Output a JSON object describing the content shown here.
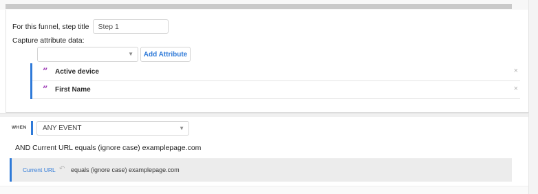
{
  "step": {
    "label": "For this funnel, step title",
    "title_value": "Step 1"
  },
  "capture": {
    "label": "Capture attribute data:",
    "select_value": "",
    "add_button": "Add Attribute",
    "attributes": [
      {
        "name": "Active device",
        "icon": "quote-icon",
        "remove": "×"
      },
      {
        "name": "First Name",
        "icon": "quote-icon",
        "remove": "×"
      }
    ]
  },
  "trigger": {
    "when_label": "WHEN",
    "event_value": "ANY EVENT",
    "and_text": "AND Current URL equals (ignore case) examplepage.com",
    "filter": {
      "field": "Current URL",
      "undo_icon": "undo-icon",
      "condition": "equals (ignore case) examplepage.com"
    }
  },
  "colors": {
    "accent": "#2f7ad8",
    "quote": "#9b37b4",
    "filter_bg": "#ececec"
  }
}
